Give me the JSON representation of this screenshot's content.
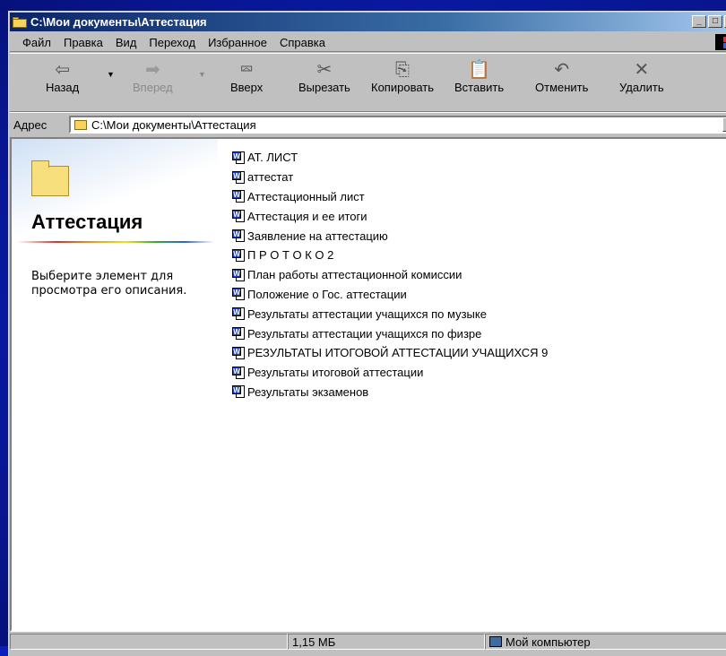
{
  "window": {
    "title": "C:\\Мои документы\\Аттестация",
    "controls": {
      "minimize": "_",
      "maximize": "□",
      "close": "✕"
    }
  },
  "menu": {
    "items": [
      {
        "label": "Файл"
      },
      {
        "label": "Правка"
      },
      {
        "label": "Вид"
      },
      {
        "label": "Переход"
      },
      {
        "label": "Избранное"
      },
      {
        "label": "Справка"
      }
    ]
  },
  "toolbar": {
    "back": {
      "label": "Назад",
      "icon": "back-arrow-icon"
    },
    "forward": {
      "label": "Вперед",
      "icon": "forward-arrow-icon",
      "disabled": true
    },
    "up": {
      "label": "Вверх",
      "icon": "up-folder-icon"
    },
    "cut": {
      "label": "Вырезать",
      "icon": "scissors-icon"
    },
    "copy": {
      "label": "Копировать",
      "icon": "copy-icon"
    },
    "paste": {
      "label": "Вставить",
      "icon": "paste-icon"
    },
    "undo": {
      "label": "Отменить",
      "icon": "undo-icon"
    },
    "delete": {
      "label": "Удалить",
      "icon": "delete-x-icon"
    }
  },
  "address": {
    "label": "Адрес",
    "value": "C:\\Мои документы\\Аттестация"
  },
  "webview": {
    "folder_title": "Аттестация",
    "description": "Выберите элемент для просмотра его описания."
  },
  "files": [
    {
      "name": "АТ. ЛИСТ"
    },
    {
      "name": "аттестат"
    },
    {
      "name": "Аттестационный лист"
    },
    {
      "name": "Аттестация и ее итоги"
    },
    {
      "name": "Заявление на  аттестацию"
    },
    {
      "name": "П Р О Т О К О 2"
    },
    {
      "name": "План работы аттестационной комиссии"
    },
    {
      "name": "Положение о Гос. аттестации"
    },
    {
      "name": "Результаты аттестации учащихся по музыке"
    },
    {
      "name": "Результаты аттестации учащихся по физре"
    },
    {
      "name": "РЕЗУЛЬТАТЫ ИТОГОВОЙ АТТЕСТАЦИИ УЧАЩИХСЯ 9"
    },
    {
      "name": "Результаты итоговой аттестации"
    },
    {
      "name": "Результаты экзаменов"
    }
  ],
  "status": {
    "size": "1,15 МБ",
    "zone": "Мой компьютер"
  },
  "colors": {
    "desktop": "#0b1fb8",
    "titlebar_start": "#0a246a",
    "titlebar_end": "#a6caf0",
    "face": "#c0c0c0"
  }
}
